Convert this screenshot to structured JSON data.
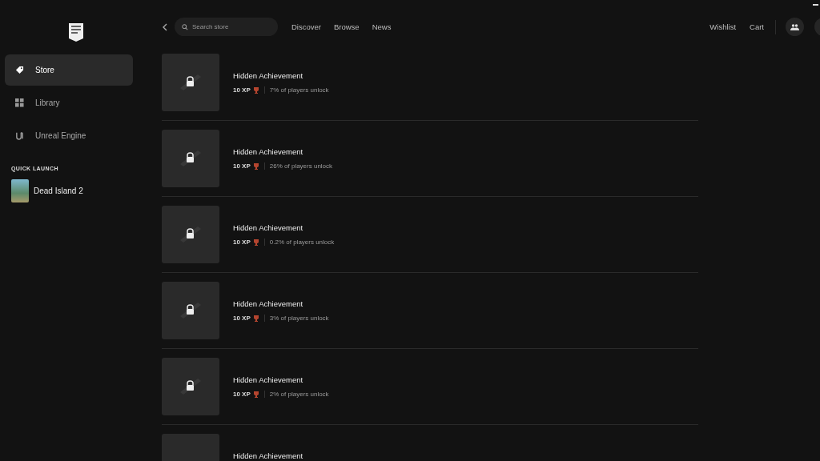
{
  "sidebar": {
    "items": [
      {
        "label": "Store",
        "selected": true
      },
      {
        "label": "Library",
        "selected": false
      },
      {
        "label": "Unreal Engine",
        "selected": false
      }
    ],
    "quick_launch": {
      "heading": "QUICK LAUNCH",
      "games": [
        {
          "title": "Dead Island 2"
        }
      ]
    }
  },
  "top_bar": {
    "search": {
      "placeholder": "Search store"
    },
    "nav": [
      "Discover",
      "Browse",
      "News"
    ],
    "right_links": [
      "Wishlist",
      "Cart"
    ]
  },
  "achievements": [
    {
      "title": "Hidden Achievement",
      "xp": "10 XP",
      "unlock": "7% of players unlock"
    },
    {
      "title": "Hidden Achievement",
      "xp": "10 XP",
      "unlock": "26% of players unlock"
    },
    {
      "title": "Hidden Achievement",
      "xp": "10 XP",
      "unlock": "0.2% of players unlock"
    },
    {
      "title": "Hidden Achievement",
      "xp": "10 XP",
      "unlock": "3% of players unlock"
    },
    {
      "title": "Hidden Achievement",
      "xp": "10 XP",
      "unlock": "2% of players unlock"
    },
    {
      "title": "Hidden Achievement"
    }
  ]
}
